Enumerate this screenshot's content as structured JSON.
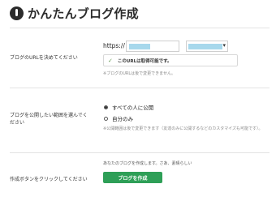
{
  "header": {
    "title": "かんたんブログ作成"
  },
  "url_section": {
    "label": "ブログのURLを決めてください",
    "protocol": "https://",
    "availability_message": "このURLは取得可能です。",
    "note": "※ブログのURLは後で変更できません。"
  },
  "visibility_section": {
    "label": "ブログを公開したい範囲を選んでください",
    "options": [
      {
        "label": "すべての人に公開",
        "selected": true
      },
      {
        "label": "自分のみ",
        "selected": false
      }
    ],
    "note": "※公開範囲は後で変更できます（友達のみに公開するなどのカスタマイズも可能です）。"
  },
  "create_section": {
    "label": "作成ボタンをクリックしてください",
    "intro": "あなたのブログを作成します。さあ、素晴らしい",
    "button_label": "ブログを作成"
  }
}
